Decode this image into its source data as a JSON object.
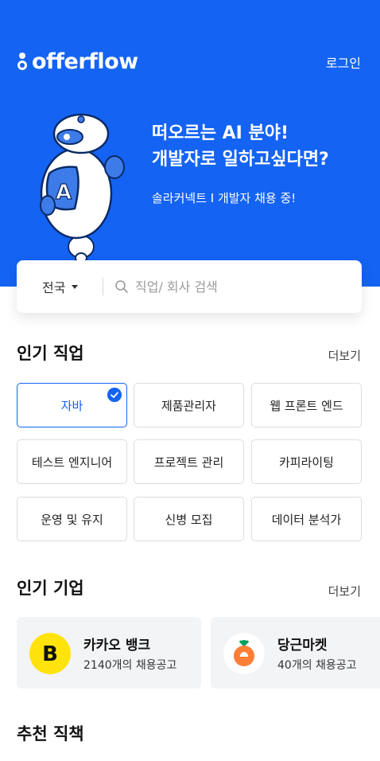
{
  "header": {
    "logo_text": "offerflow",
    "login_label": "로그인"
  },
  "banner": {
    "headline_line1": "떠오르는 AI 분야!",
    "headline_line2": "개발자로 일하고싶다면?",
    "subtext": "솔라커넥트 I 개발자 채용 중!",
    "mascot_badge_letter": "A"
  },
  "search": {
    "region": "전국",
    "placeholder": "직업/ 회사 검색"
  },
  "popular_jobs": {
    "title": "인기 직업",
    "more_label": "더보기",
    "chips": [
      {
        "label": "자바",
        "selected": true
      },
      {
        "label": "제품관리자",
        "selected": false
      },
      {
        "label": "웹 프론트 엔드",
        "selected": false
      },
      {
        "label": "테스트 엔지니어",
        "selected": false
      },
      {
        "label": "프로젝트 관리",
        "selected": false
      },
      {
        "label": "카피라이팅",
        "selected": false
      },
      {
        "label": "운영 및 유지",
        "selected": false
      },
      {
        "label": "신병 모집",
        "selected": false
      },
      {
        "label": "데이터 분석가",
        "selected": false
      }
    ]
  },
  "popular_companies": {
    "title": "인기 기업",
    "more_label": "더보기",
    "items": [
      {
        "name": "카카오 뱅크",
        "postings": "2140개의 채용공고",
        "logo_letter": "B",
        "logo_color": "#ffe30b",
        "icon": "kakaobank-logo-icon"
      },
      {
        "name": "당근마켓",
        "postings": "40개의 채용공고",
        "logo_color": "#ff7e36",
        "icon": "carrot-logo-icon"
      }
    ]
  },
  "recommended": {
    "title": "추천 직책"
  },
  "colors": {
    "brand_blue": "#1463f3",
    "chip_border": "#dcdcdc",
    "card_bg": "#f3f4f6"
  }
}
